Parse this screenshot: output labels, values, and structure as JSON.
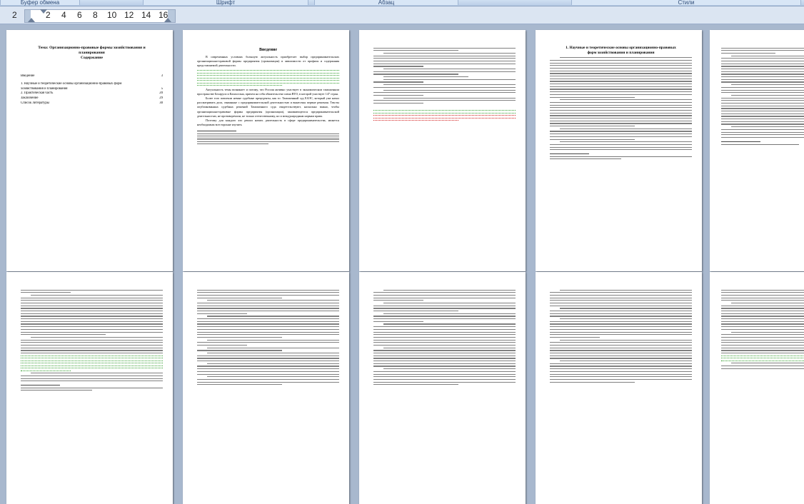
{
  "ribbon": {
    "groups": [
      "Буфер обмена",
      "Шрифт",
      "Абзац",
      "Стили"
    ]
  },
  "ruler": {
    "numbers": [
      "2",
      "2",
      "4",
      "6",
      "8",
      "10",
      "12",
      "14",
      "16"
    ]
  },
  "colors": {
    "workspace": "#a8b8ce",
    "spelling_error": "#d01818",
    "grammar_error": "#2f9c2a"
  },
  "page1": {
    "title_line1": "Тема: Организационно-правовые формы хозяйствования и",
    "title_line2": "планирования",
    "contents_heading": "Содержание",
    "toc": [
      {
        "label": "Введение",
        "page": "3"
      },
      {
        "label": "1.   Научные и теоретические основы организационно-правовых форм",
        "page": ""
      },
      {
        "label": "хозяйствования и планирования",
        "page": "5"
      },
      {
        "label": "2.   Практическая часть",
        "page": "20"
      },
      {
        "label": "Заключение",
        "page": "29"
      },
      {
        "label": "Список литературы",
        "page": "30"
      }
    ]
  },
  "page2": {
    "heading": "Введение",
    "para1": "В современных условиях большую актуальность приобретает выбор предпринимательских организационно-правовой формы предприятия (организации) в зависимости от профиля и содержания представляемой деятельности.",
    "para2": "Актуальность темы возникает и потому, что Россия активно участвует в экономическом таможенном пространстве Беларуси и Казахстана, причем на себя обязательства члена ВТО, в которой участвует 147 стран.",
    "para3": "Более того повлекли немые судебные прецеденты, как то: Таможенный суд ЕАЭС, который уже начал рассматривать дела, связанные с предпринимательской деятельностью и вынесены первые решения. Тексты опубликованных судебных решений Таможенного суда свидетельствуют, насколько важно, чтобы организационно-правовые формы предприятия (организации), занимающегося предпринимательской деятельностью, не противоречили, не только отечественному, но и международным нормам права.",
    "para4": "Поэтому для каждого кто решил начать деятельность в сфере предпринимательства, является необходимым всесторонне изучить"
  },
  "page4": {
    "heading_line1": "1.   Научные и теоретические основы организационно-правовых",
    "heading_line2": "форм хозяйствования и планирования"
  }
}
